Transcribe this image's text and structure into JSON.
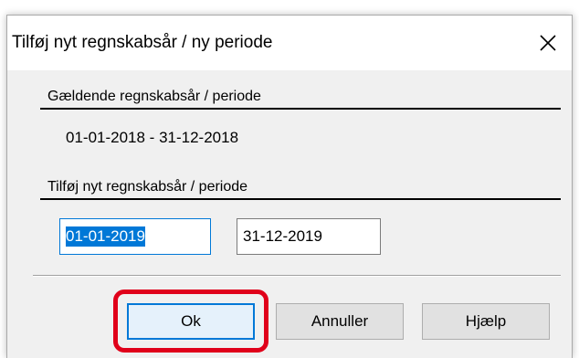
{
  "dialog": {
    "title": "Tilføj nyt regnskabsår / ny periode",
    "close_symbol": "✕",
    "current_section_label": "Gældende regnskabsår / periode",
    "current_period": "01-01-2018 - 31-12-2018",
    "new_section_label": "Tilføj nyt regnskabsår / periode",
    "new_start_date": "01-01-2019",
    "new_end_date": "31-12-2019"
  },
  "buttons": {
    "ok_label": "Ok",
    "cancel_label": "Annuller",
    "help_label": "Hjælp"
  },
  "colors": {
    "focus_accent": "#0078d7",
    "highlight_annotation": "#e0001a"
  }
}
